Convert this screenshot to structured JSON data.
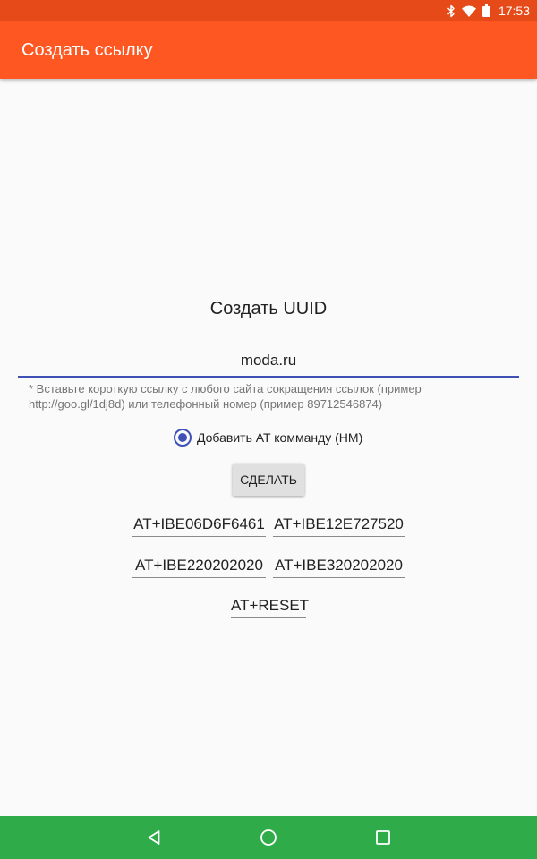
{
  "status_bar": {
    "time": "17:53",
    "icons": [
      "bluetooth-icon",
      "wifi-icon",
      "battery-icon"
    ]
  },
  "app_bar": {
    "title": "Создать ссылку"
  },
  "main": {
    "heading": "Создать UUID",
    "url_input": {
      "value": "moda.ru"
    },
    "hint": "* Вставьте короткую ссылку с любого сайта сокращения ссылок (пример http://goo.gl/1dj8d) или телефонный номер (пример 89712546874)",
    "radio": {
      "label": "Добавить AT комманду (НМ)",
      "checked": true
    },
    "make_button": "СДЕЛАТЬ",
    "at_commands": [
      "AT+IBE06D6F6461",
      "AT+IBE12E727520",
      "AT+IBE220202020",
      "AT+IBE320202020",
      "AT+RESET"
    ]
  },
  "nav_bar": {
    "icons": [
      "back-icon",
      "home-icon",
      "recents-icon"
    ]
  },
  "colors": {
    "status_bar": "#e64a19",
    "app_bar": "#ff5722",
    "accent": "#3f51b5",
    "nav_bar": "#2fab4a",
    "background": "#fafafa"
  }
}
